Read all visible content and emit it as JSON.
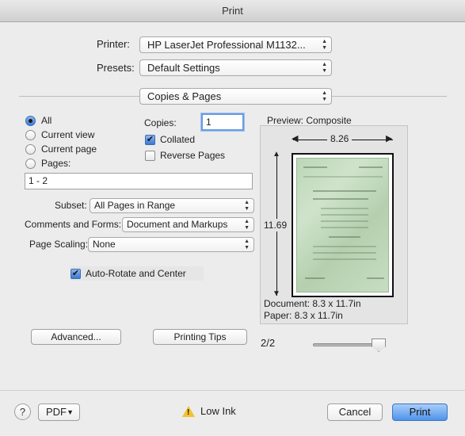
{
  "window": {
    "title": "Print"
  },
  "printer": {
    "label": "Printer:",
    "value": "HP LaserJet Professional M1132..."
  },
  "presets": {
    "label": "Presets:",
    "value": "Default Settings"
  },
  "section": {
    "value": "Copies & Pages"
  },
  "pages": {
    "options": [
      "All",
      "Current view",
      "Current page",
      "Pages:"
    ],
    "selected_index": 0,
    "range_value": "1 - 2"
  },
  "copies": {
    "label": "Copies:",
    "value": "1"
  },
  "collated": {
    "label": "Collated",
    "checked": true
  },
  "reverse_pages": {
    "label": "Reverse Pages",
    "checked": false
  },
  "subset": {
    "label": "Subset:",
    "value": "All Pages in Range"
  },
  "comments_forms": {
    "label": "Comments and Forms:",
    "value": "Document and Markups"
  },
  "page_scaling": {
    "label": "Page Scaling:",
    "value": "None"
  },
  "auto_rotate": {
    "label": "Auto-Rotate and Center",
    "checked": true
  },
  "buttons": {
    "advanced": "Advanced...",
    "printing_tips": "Printing Tips",
    "pdf": "PDF",
    "cancel": "Cancel",
    "print": "Print",
    "help": "?"
  },
  "preview": {
    "title": "Preview: Composite",
    "width_label": "8.26",
    "height_label": "11.69",
    "document_size": "Document: 8.3 x 11.7in",
    "paper_size": "Paper: 8.3 x 11.7in",
    "page_indicator": "2/2",
    "slider_position": 1.0
  },
  "status": {
    "warning_text": "Low Ink"
  },
  "icons": {
    "help": "help-icon",
    "warning": "warning-icon",
    "dropdown": "chevron-updown-icon"
  }
}
